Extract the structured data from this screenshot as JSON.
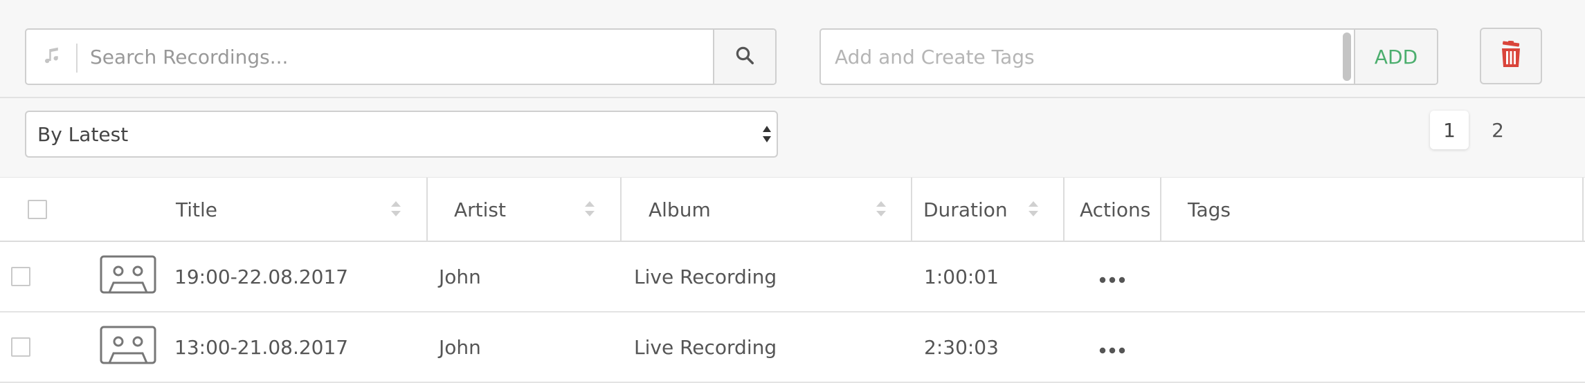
{
  "toolbar": {
    "search_placeholder": "Search Recordings...",
    "tags_placeholder": "Add and Create Tags",
    "add_label": "ADD"
  },
  "sort": {
    "selected": "By Latest"
  },
  "pagination": {
    "pages": [
      "1",
      "2"
    ],
    "current": "1"
  },
  "table": {
    "columns": [
      "Title",
      "Artist",
      "Album",
      "Duration",
      "Actions",
      "Tags"
    ],
    "rows": [
      {
        "title": "19:00-22.08.2017",
        "artist": "John",
        "album": "Live Recording",
        "duration": "1:00:01",
        "tags": ""
      },
      {
        "title": "13:00-21.08.2017",
        "artist": "John",
        "album": "Live Recording",
        "duration": "2:30:03",
        "tags": ""
      }
    ]
  },
  "colors": {
    "add_green": "#4cae6e",
    "trash_red": "#d9443a"
  },
  "icons": {
    "search_addon": "music-note-icon",
    "search_button": "magnifier-icon",
    "trash": "trash-icon",
    "row_thumb": "cassette-icon",
    "actions": "ellipsis-icon"
  }
}
